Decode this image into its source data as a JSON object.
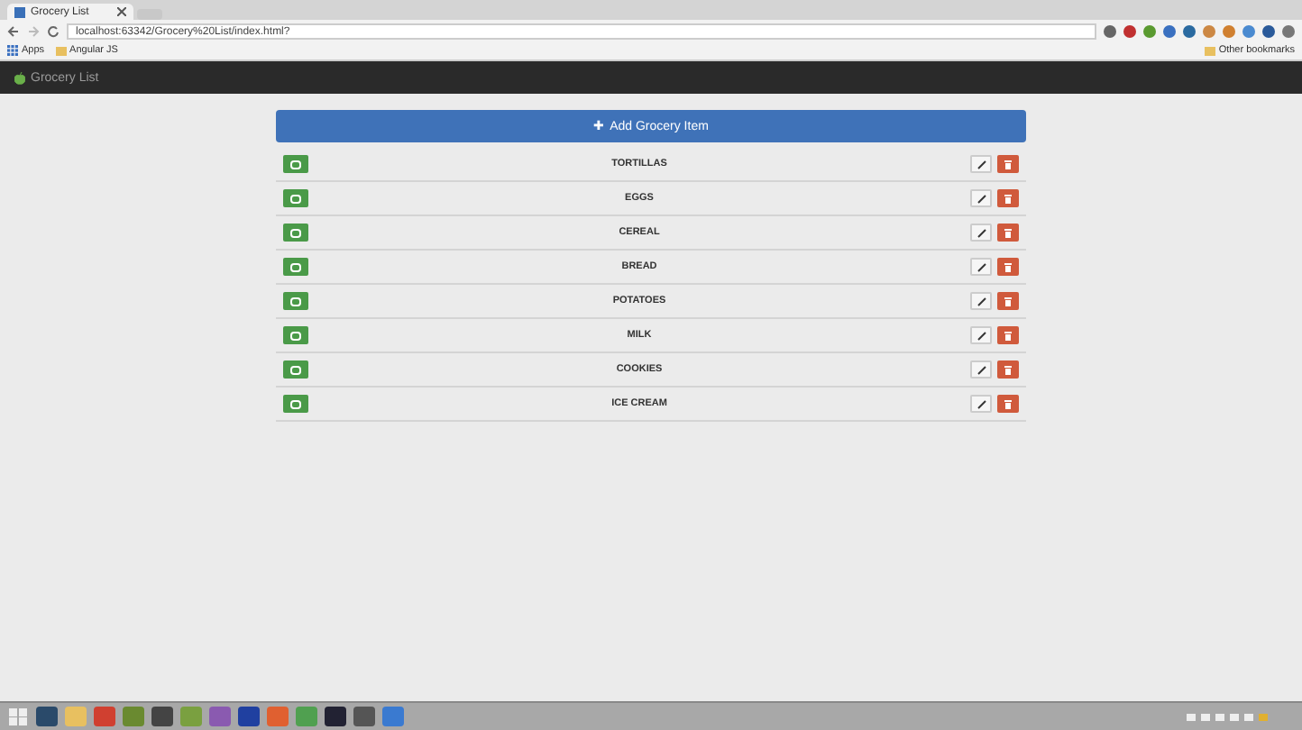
{
  "browser": {
    "tab_title": "Grocery List",
    "address": "localhost:63342/Grocery%20List/index.html?",
    "bookmarks": [
      "Apps",
      "Angular JS"
    ],
    "other_bookmarks": "Other bookmarks"
  },
  "navbar": {
    "brand": "Grocery List"
  },
  "add_button": {
    "icon": "✚",
    "label": "Add Grocery Item"
  },
  "items": [
    {
      "name": "TORTILLAS"
    },
    {
      "name": "EGGS"
    },
    {
      "name": "CEREAL"
    },
    {
      "name": "BREAD"
    },
    {
      "name": "POTATOES"
    },
    {
      "name": "MILK"
    },
    {
      "name": "COOKIES"
    },
    {
      "name": "ICE CREAM"
    }
  ]
}
